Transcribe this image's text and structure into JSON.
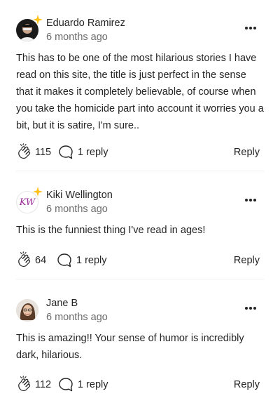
{
  "comments": [
    {
      "author": "Eduardo Ramirez",
      "time": "6 months ago",
      "text": "This has to be one of the most hilarious stories I have read on this site, the title is just perfect in the sense that it makes it completely believable, of course when you take the homicide part into account it worries you a bit, but it is satire, I'm sure..",
      "claps": "115",
      "replies": "1 reply",
      "reply_label": "Reply",
      "avatar_icon": "person-avatar-dark",
      "has_star": true
    },
    {
      "author": "Kiki Wellington",
      "time": "6 months ago",
      "text": "This is the funniest thing I've read in ages!",
      "claps": "64",
      "replies": "1 reply",
      "reply_label": "Reply",
      "avatar_icon": "kw-monogram-avatar",
      "avatar_monogram": "KW",
      "has_star": true
    },
    {
      "author": "Jane B",
      "time": "6 months ago",
      "text": "This is amazing!! Your sense of humor is incredibly dark, hilarious.",
      "claps": "112",
      "replies": "1 reply",
      "reply_label": "Reply",
      "avatar_icon": "person-avatar-photo",
      "has_star": false
    }
  ],
  "colors": {
    "text": "#242424",
    "muted": "#6b6b6b",
    "star": "#ffc017",
    "monogram": "#9b2c9b"
  }
}
